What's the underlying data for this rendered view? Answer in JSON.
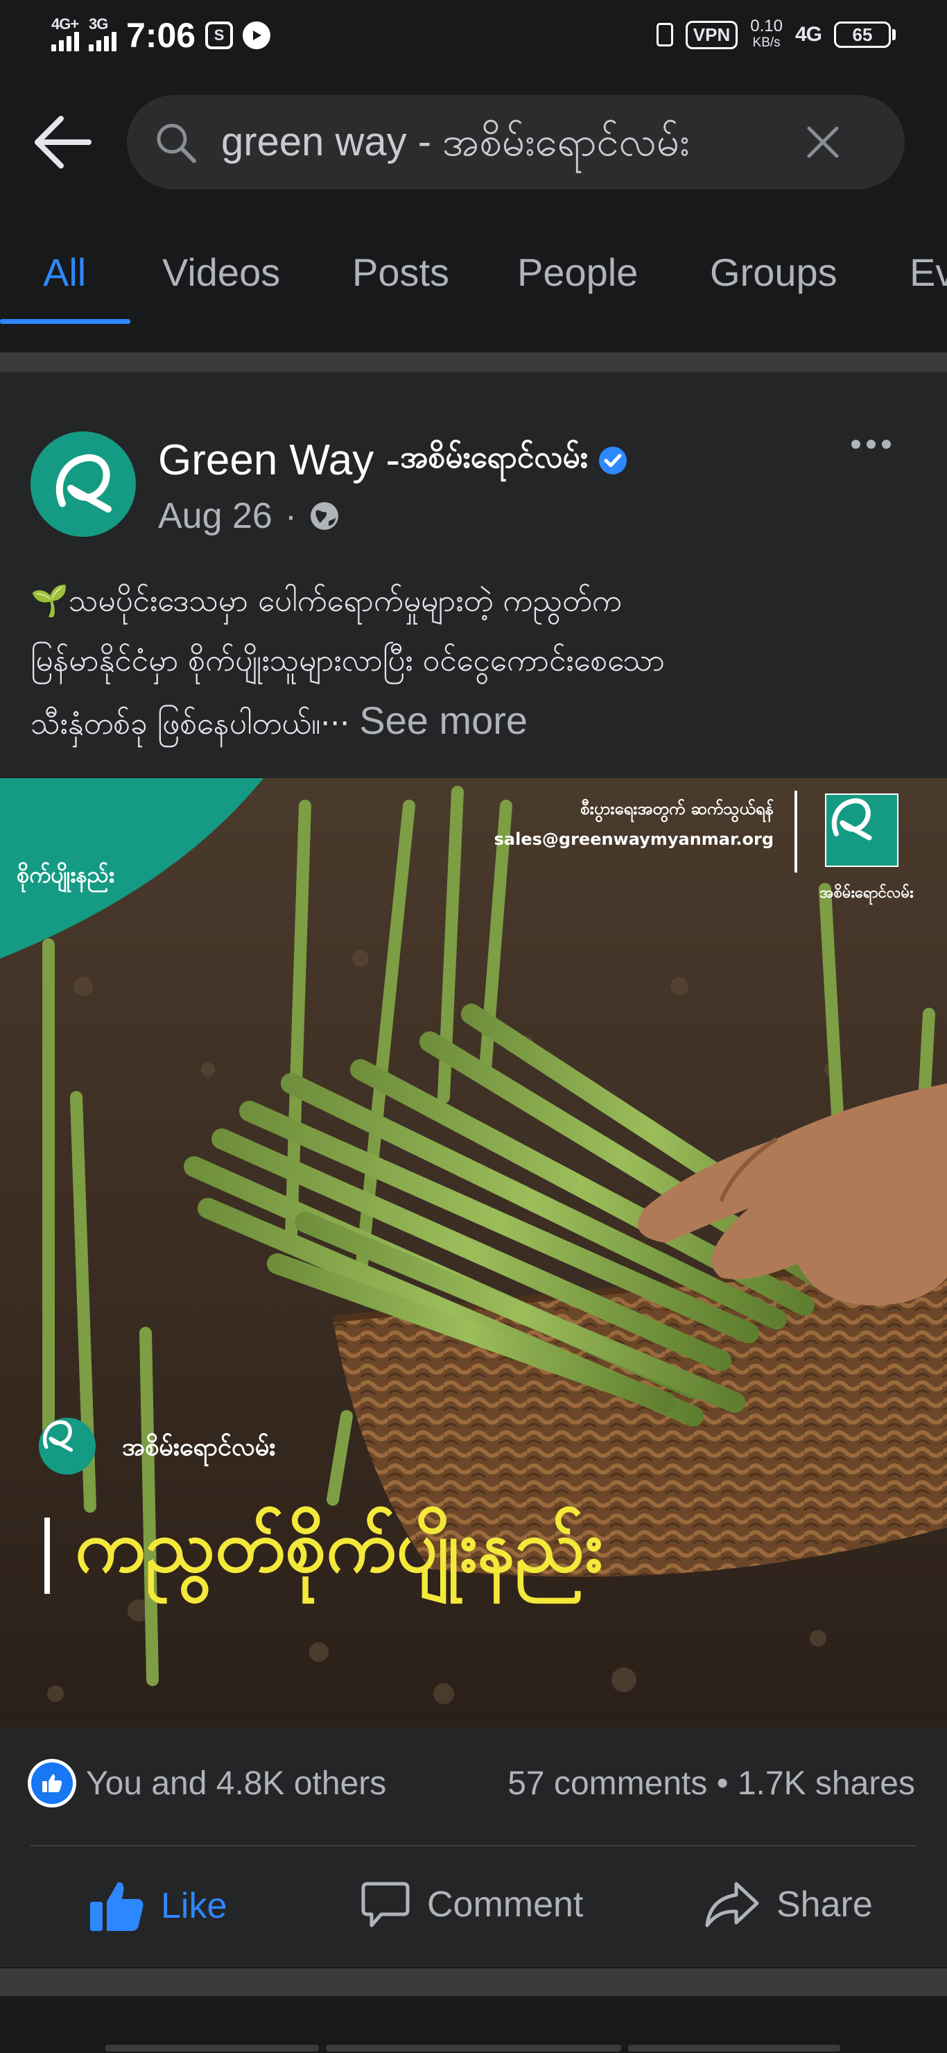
{
  "status_bar": {
    "network_left_1": "4G+",
    "network_left_2": "3G",
    "time": "7:06",
    "vpn": "VPN",
    "speed_value": "0.10",
    "speed_unit": "KB/s",
    "network_right": "4G",
    "battery": "65"
  },
  "search": {
    "query": "green way - အစိမ်းရောင်လမ်း"
  },
  "tabs": [
    "All",
    "Videos",
    "Posts",
    "People",
    "Groups",
    "Ev"
  ],
  "post": {
    "page_name": "Green Way - ",
    "page_name_mm": "အစိမ်းရောင်လမ်း",
    "date": "Aug 26",
    "text_line_1": "🌱သမပိုင်းဒေသမှာ ပေါက်ရောက်မှုများတဲ့ ကညွတ်က",
    "text_line_2": "မြန်မာနိုင်ငံမှာ စိုက်ပျိုးသူများလာပြီး ဝင်ငွေကောင်းစေသော",
    "text_line_3": "သီးနှံတစ်ခု ဖြစ်နေပါတယ်။··· ",
    "see_more": "See more",
    "image": {
      "corner_label": "စိုက်ပျိုးနည်း",
      "contact_line_1": "စီးပွားရေးအတွက် ဆက်သွယ်ရန်",
      "contact_line_2": "sales@greenwaymyanmar.org",
      "logo_caption": "အစိမ်းရောင်လမ်း",
      "brand": "အစိမ်းရောင်လမ်း",
      "title": "ကညွတ်စိုက်ပျိုးနည်း"
    },
    "reactions_text": "You and 4.8K others",
    "comments": "57 comments",
    "shares": "1.7K shares",
    "actions": {
      "like": "Like",
      "comment": "Comment",
      "share": "Share"
    }
  },
  "colors": {
    "accent": "#2d88ff",
    "brand_teal": "#159b83",
    "background": "#18191a",
    "card": "#242526",
    "title_yellow": "#f4e93a"
  }
}
